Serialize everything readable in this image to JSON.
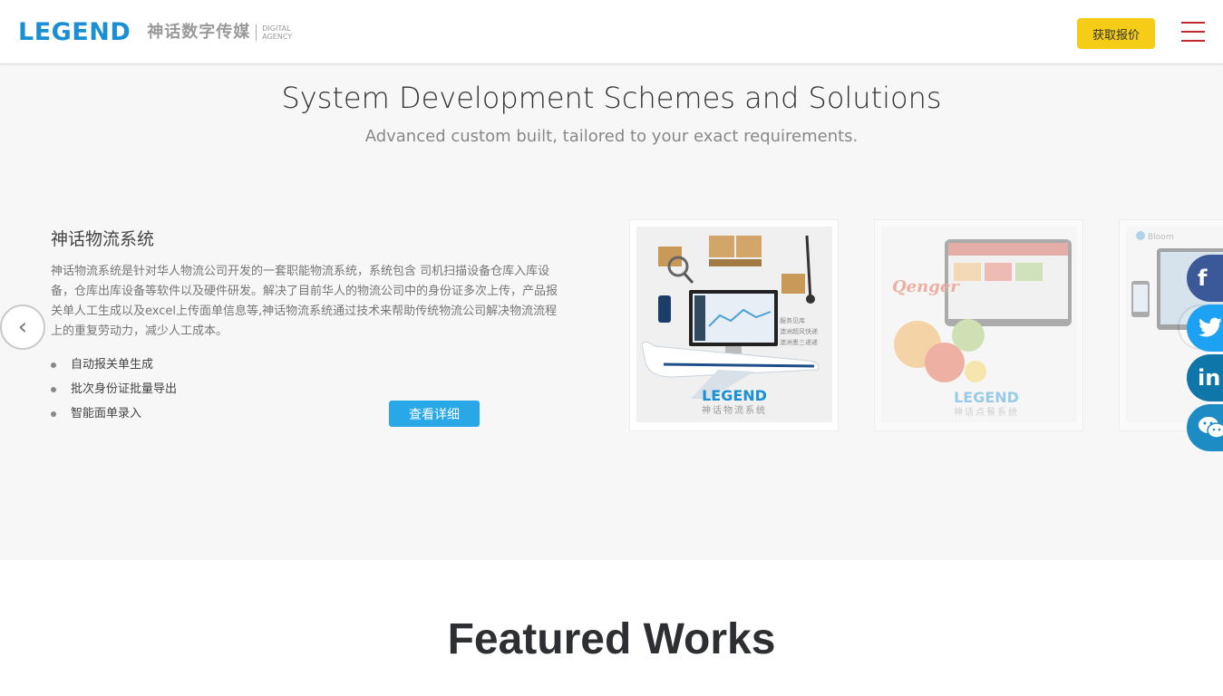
{
  "header": {
    "logo_text": "LEGEND",
    "logo_cn": "神话数字传媒",
    "logo_sub_line1": "DIGITAL",
    "logo_sub_line2": "AGENCY",
    "quote_button": "获取报价",
    "menu_icon": "hamburger-icon"
  },
  "solutions": {
    "title": "System Development Schemes and Solutions",
    "subtitle": "Advanced custom built, tailored to your exact requirements.",
    "product": {
      "name": "神话物流系统",
      "description": "神话物流系统是针对华人物流公司开发的一套职能物流系统，系统包含 司机扫描设备仓库入库设备，仓库出库设备等软件以及硬件研发。解决了目前华人的物流公司中的身份证多次上传，产品报关单人工生成以及excel上传面单信息等,神话物流系统通过技术来帮助传统物流公司解决物流流程上的重复劳动力，减少人工成本。",
      "features": [
        "自动报关单生成",
        "批次身份证批量导出",
        "智能面单录入"
      ],
      "detail_button": "查看详细"
    },
    "cards": [
      {
        "brand": "LEGEND",
        "caption": "神话物流系统",
        "side_text": [
          "服务见库",
          "澳洲超风快递",
          "澳洲墨三递递"
        ]
      },
      {
        "brand": "LEGEND",
        "caption": "神话点餐系统",
        "script_word": "Qenger"
      },
      {
        "brand": "Bloom"
      }
    ],
    "arrow_left": "‹"
  },
  "social": {
    "facebook": "f",
    "twitter": "twitter-bird",
    "linkedin": "in",
    "wechat": "wechat-icon"
  },
  "featured": {
    "title": "Featured Works"
  },
  "colors": {
    "brand_blue": "#1a8fd4",
    "quote_yellow": "#f5cc16",
    "menu_red": "#c4262e",
    "detail_blue": "#29a8e8"
  }
}
